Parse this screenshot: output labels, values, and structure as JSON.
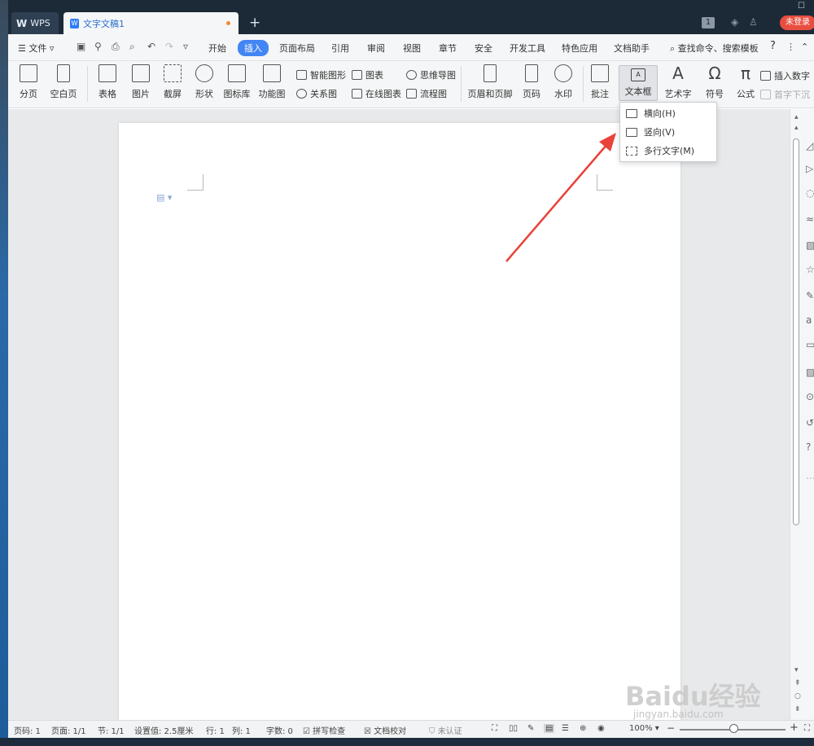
{
  "titlebar": {
    "wps_tab": "WPS",
    "doc_tab": "文字文稿1",
    "new_tab": "+",
    "badge": "1",
    "login": "未登录"
  },
  "menubar": {
    "file": "文件",
    "items": [
      "开始",
      "插入",
      "页面布局",
      "引用",
      "审阅",
      "视图",
      "章节",
      "安全",
      "开发工具",
      "特色应用",
      "文档助手"
    ],
    "active": "插入",
    "search": "查找命令、搜索模板",
    "help": "?"
  },
  "ribbon": {
    "page_break": "分页",
    "blank_page": "空白页",
    "table": "表格",
    "picture": "图片",
    "screenshot": "截屏",
    "shape": "形状",
    "icon_lib": "图标库",
    "func_chart": "功能图",
    "smart_shape": "智能图形",
    "chart": "图表",
    "mind_map": "思维导图",
    "relation": "关系图",
    "online_chart": "在线图表",
    "flowchart": "流程图",
    "header_footer": "页眉和页脚",
    "page_num": "页码",
    "watermark": "水印",
    "comment": "批注",
    "textbox": "文本框",
    "wordart": "艺术字",
    "symbol": "符号",
    "formula": "公式",
    "insert_number": "插入数字",
    "drop_cap": "首字下沉"
  },
  "dropdown": {
    "items": [
      "横向(H)",
      "竖向(V)",
      "多行文字(M)"
    ]
  },
  "statusbar": {
    "page_code": "页码: 1",
    "page": "页面: 1/1",
    "section": "节: 1/1",
    "setting": "设置值: 2.5厘米",
    "row": "行: 1",
    "col": "列: 1",
    "words": "字数: 0",
    "spell": "拼写检查",
    "proof": "文档校对",
    "cert": "未认证",
    "zoom": "100%"
  },
  "watermark": {
    "brand": "Baidu经验",
    "url": "jingyan.baidu.com"
  }
}
